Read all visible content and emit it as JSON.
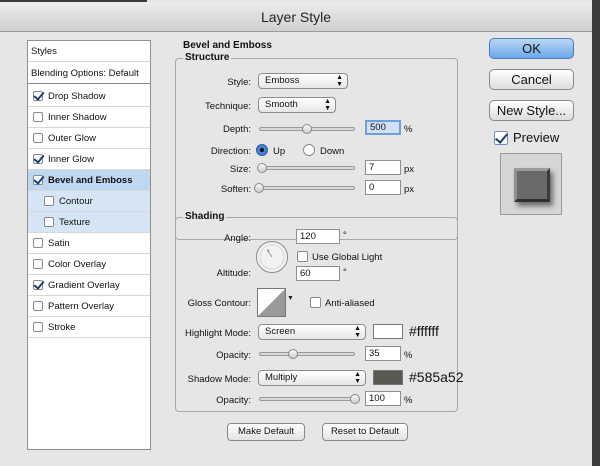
{
  "window": {
    "title": "Layer Style"
  },
  "styles_list": {
    "header": "Styles",
    "blending": "Blending Options: Default",
    "items": [
      {
        "label": "Drop Shadow",
        "checked": true
      },
      {
        "label": "Inner Shadow",
        "checked": false
      },
      {
        "label": "Outer Glow",
        "checked": false
      },
      {
        "label": "Inner Glow",
        "checked": true
      },
      {
        "label": "Bevel and Emboss",
        "checked": true
      },
      {
        "label": "Contour",
        "checked": false
      },
      {
        "label": "Texture",
        "checked": false
      },
      {
        "label": "Satin",
        "checked": false
      },
      {
        "label": "Color Overlay",
        "checked": false
      },
      {
        "label": "Gradient Overlay",
        "checked": true
      },
      {
        "label": "Pattern Overlay",
        "checked": false
      },
      {
        "label": "Stroke",
        "checked": false
      }
    ]
  },
  "panel": {
    "title": "Bevel and Emboss",
    "structure": {
      "title": "Structure",
      "style_label": "Style:",
      "style_value": "Emboss",
      "technique_label": "Technique:",
      "technique_value": "Smooth",
      "depth_label": "Depth:",
      "depth_value": "500",
      "depth_unit": "%",
      "depth_slider": 0.5,
      "direction_label": "Direction:",
      "direction_up": "Up",
      "direction_down": "Down",
      "direction_selected": "Up",
      "size_label": "Size:",
      "size_value": "7",
      "size_unit": "px",
      "size_slider": 0.03,
      "soften_label": "Soften:",
      "soften_value": "0",
      "soften_unit": "px",
      "soften_slider": 0.0
    },
    "shading": {
      "title": "Shading",
      "angle_label": "Angle:",
      "angle_value": "120",
      "angle_unit": "°",
      "global_light_label": "Use Global Light",
      "global_light_checked": false,
      "altitude_label": "Altitude:",
      "altitude_value": "60",
      "altitude_unit": "°",
      "gloss_label": "Gloss Contour:",
      "anti_aliased_label": "Anti-aliased",
      "anti_aliased_checked": false,
      "highlight_label": "Highlight Mode:",
      "highlight_value": "Screen",
      "highlight_color": "#ffffff",
      "highlight_tag": "#ffffff",
      "highlight_opacity_label": "Opacity:",
      "highlight_opacity_value": "35",
      "highlight_opacity_unit": "%",
      "highlight_opacity_slider": 0.35,
      "shadow_label": "Shadow Mode:",
      "shadow_value": "Multiply",
      "shadow_color": "#585a52",
      "shadow_tag": "#585a52",
      "shadow_opacity_label": "Opacity:",
      "shadow_opacity_value": "100",
      "shadow_opacity_unit": "%",
      "shadow_opacity_slider": 1.0
    },
    "buttons": {
      "make_default": "Make Default",
      "reset_default": "Reset to Default"
    }
  },
  "actions": {
    "ok": "OK",
    "cancel": "Cancel",
    "new_style": "New Style...",
    "preview_label": "Preview",
    "preview_checked": true
  }
}
